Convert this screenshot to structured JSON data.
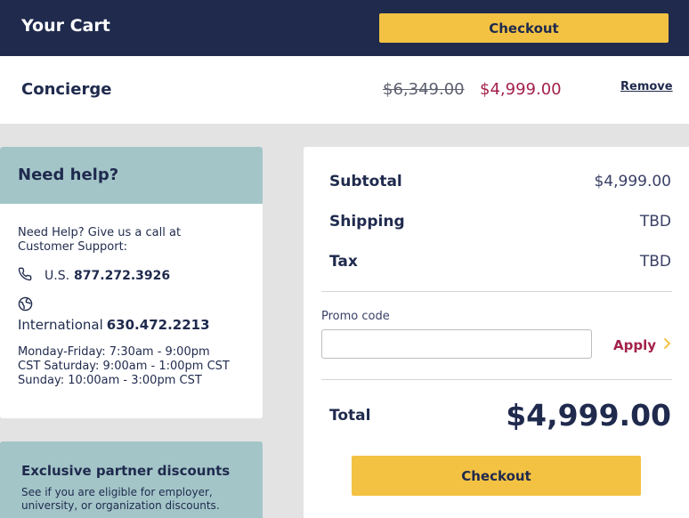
{
  "header": {
    "title": "Your Cart",
    "checkout_label": "Checkout"
  },
  "cart_item": {
    "name": "Concierge",
    "original_price": "$6,349.00",
    "sale_price": "$4,999.00",
    "remove_label": "Remove"
  },
  "help": {
    "heading": "Need help?",
    "intro": "Need Help? Give us a call at Customer Support:",
    "us_label": "U.S.",
    "us_number": "877.272.3926",
    "intl_label": "International",
    "intl_number": "630.472.2213",
    "hours": "Monday-Friday: 7:30am - 9:00pm CST Saturday: 9:00am - 1:00pm CST Sunday: 10:00am - 3:00pm CST"
  },
  "partner": {
    "heading": "Exclusive partner discounts",
    "text": "See if you are eligible for employer, university, or organization discounts."
  },
  "summary": {
    "subtotal_label": "Subtotal",
    "subtotal_value": "$4,999.00",
    "shipping_label": "Shipping",
    "shipping_value": "TBD",
    "tax_label": "Tax",
    "tax_value": "TBD",
    "promo_label": "Promo code",
    "promo_value": "",
    "apply_label": "Apply",
    "total_label": "Total",
    "total_value": "$4,999.00",
    "checkout_label": "Checkout"
  },
  "colors": {
    "navy": "#1f2a4d",
    "accent_yellow": "#f4c243",
    "sale_red": "#a3214a",
    "teal": "#a3c5c8"
  },
  "icons": {
    "phone": "phone-icon",
    "globe": "globe-icon",
    "apply": "chevron-right-icon"
  }
}
